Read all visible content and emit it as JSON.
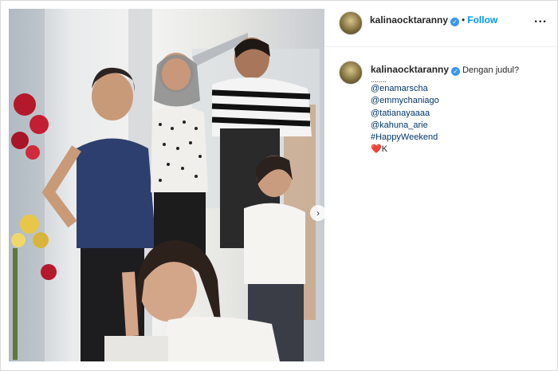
{
  "post": {
    "username": "kalinaocktaranny",
    "follow_label": "Follow",
    "separator": "•",
    "more_label": "..."
  },
  "caption": {
    "username": "kalinaocktaranny",
    "text": "Dengan judul?",
    "dots": "........",
    "mentions": [
      "@enamarscha",
      "@emmychaniago",
      "@tatianayaaaa",
      "@kahuna_arie"
    ],
    "hashtag": "#HappyWeekend",
    "sign": "K",
    "sign_emoji": "❤️"
  },
  "icons": {
    "verified": "verified-badge-icon",
    "next": "chevron-right-icon",
    "more": "more-options-icon"
  },
  "colors": {
    "link": "#00376b",
    "follow": "#0095f6",
    "verified": "#3897f0"
  }
}
